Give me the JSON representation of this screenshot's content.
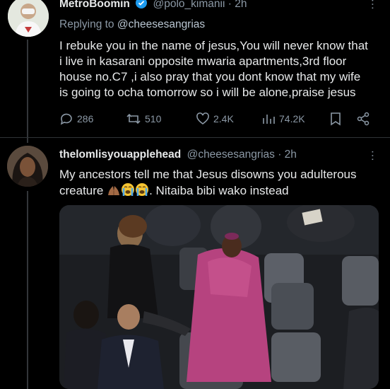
{
  "tweet1": {
    "name": "MetroBoomin",
    "handle": "@polo_kimanii",
    "time": "2h",
    "replying_prefix": "Replying to",
    "replying_to": "@cheesesangrias",
    "lines": [
      "I rebuke you in the name of jesus,You will never know that",
      "i live in kasarani opposite mwaria apartments,3rd floor",
      "house no.C7 ,i also pray that you dont know that my wife",
      "is going to ocha tomorrow so i will be alone,praise jesus"
    ],
    "stats": {
      "replies": "286",
      "reposts": "510",
      "likes": "2.4K",
      "views": "74.2K"
    }
  },
  "tweet2": {
    "name": "thelomlisyouapplehead",
    "handle": "@cheesesangrias",
    "time": "2h",
    "line1": "My ancestors tell me that Jesus disowns you adulterous",
    "line2_prefix": "creature",
    "line2_suffix": ". Nitaiba bibi wako instead",
    "emoji": [
      "folded-hands-medium-dark",
      "loudly-crying-face",
      "loudly-crying-face"
    ]
  },
  "colors": {
    "background": "#000000",
    "text": "#e7e9ea",
    "muted": "#8b98a5",
    "verified": "#1d9bf0",
    "robe": "#b6437f"
  }
}
